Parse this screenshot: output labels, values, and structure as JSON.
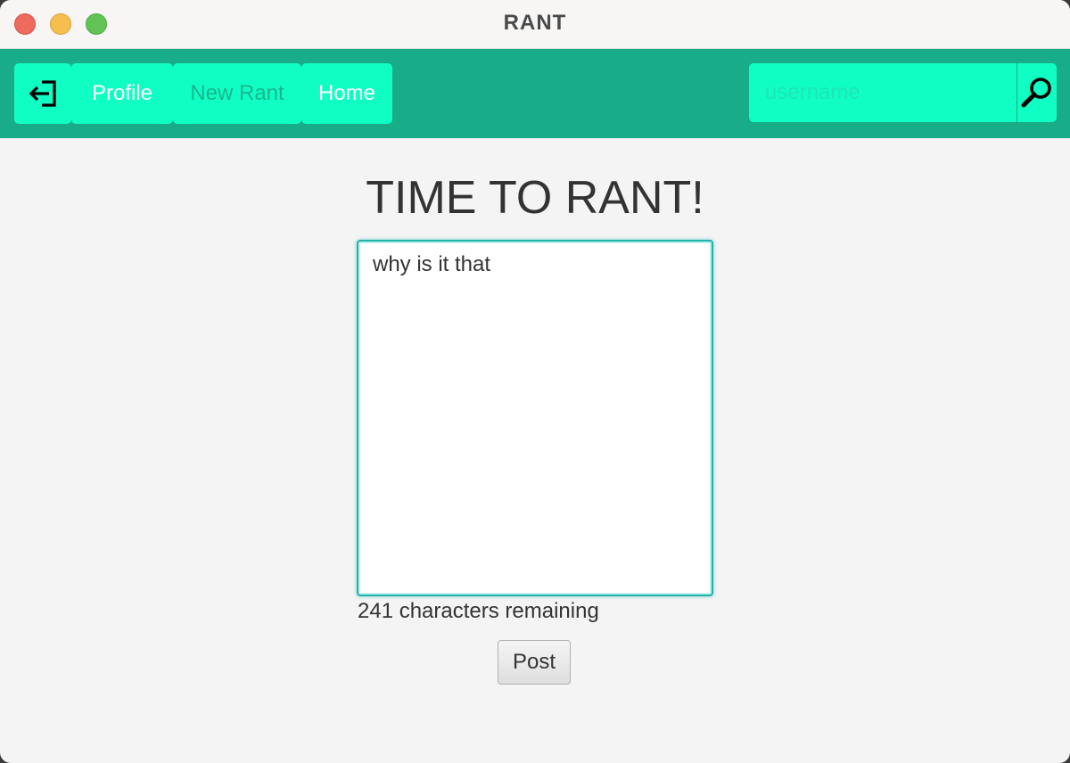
{
  "window": {
    "title": "RANT"
  },
  "nav": {
    "logout_icon": "logout-icon",
    "items": [
      {
        "label": "Profile"
      },
      {
        "label": "New Rant"
      },
      {
        "label": "Home"
      }
    ],
    "search": {
      "placeholder": "username",
      "value": "",
      "icon": "search-icon"
    }
  },
  "main": {
    "heading": "TIME TO RANT!",
    "rant_text": "why is it that",
    "remaining_text": "241 characters remaining",
    "post_label": "Post"
  },
  "colors": {
    "navbar": "#18ac88",
    "nav_button": "#10fec4",
    "accent_border": "#1fb3aa"
  }
}
